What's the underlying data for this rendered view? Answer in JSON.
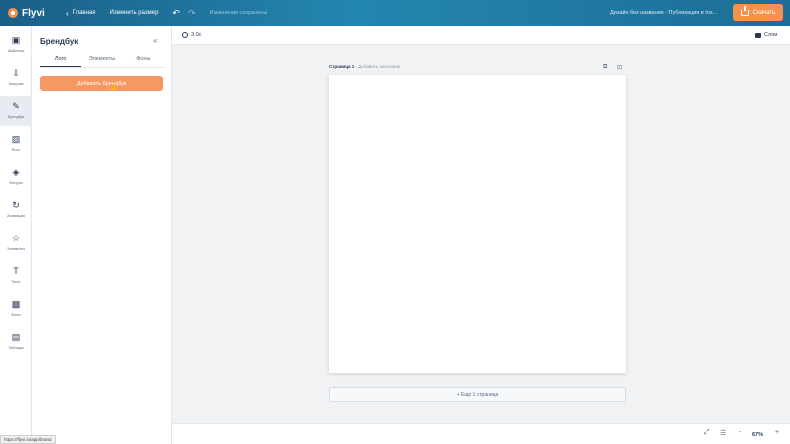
{
  "topbar": {
    "logo_text": "Flyvi",
    "home_label": "Главная",
    "resize_label": "Изменить размер",
    "undo_icon": "undo-icon",
    "redo_icon": "redo-icon",
    "saved_label": "Изменения сохранены",
    "design_title": "Дизайн без названия - Публикация в Ins...",
    "download_label": "Скачать",
    "accent_color": "#f5924f"
  },
  "iconbar": {
    "items": [
      {
        "icon": "layout-icon",
        "label": "Шаблоны",
        "active": false
      },
      {
        "icon": "upload-icon",
        "label": "Загрузки",
        "active": false
      },
      {
        "icon": "brandbook-icon",
        "label": "Брендбук",
        "active": true
      },
      {
        "icon": "photo-icon",
        "label": "Фото",
        "active": false
      },
      {
        "icon": "shapes-icon",
        "label": "Фигуры",
        "active": false
      },
      {
        "icon": "animation-icon",
        "label": "Анимация",
        "active": false
      },
      {
        "icon": "star-icon",
        "label": "Элементы",
        "active": false
      },
      {
        "icon": "text-icon",
        "label": "Текст",
        "active": false
      },
      {
        "icon": "pattern-icon",
        "label": "Фоны",
        "active": false
      },
      {
        "icon": "table-icon",
        "label": "Таблицы",
        "active": false
      }
    ]
  },
  "panel": {
    "title": "Брендбук",
    "tabs": [
      "Лого",
      "Элементы",
      "Фоны"
    ],
    "active_tab": "Лого",
    "add_button_label": "Добавить брендбук"
  },
  "canvas_toolbar": {
    "size_label": "3.0с",
    "layers_label": "Слои"
  },
  "canvas": {
    "page_label": "Страница 1",
    "page_sub": " - Добавить заголовок",
    "add_page_label": "+ Еще 1 страница"
  },
  "bottombar": {
    "zoom_value": "67%"
  },
  "status_url": "https://flyvi.io/app/brand"
}
